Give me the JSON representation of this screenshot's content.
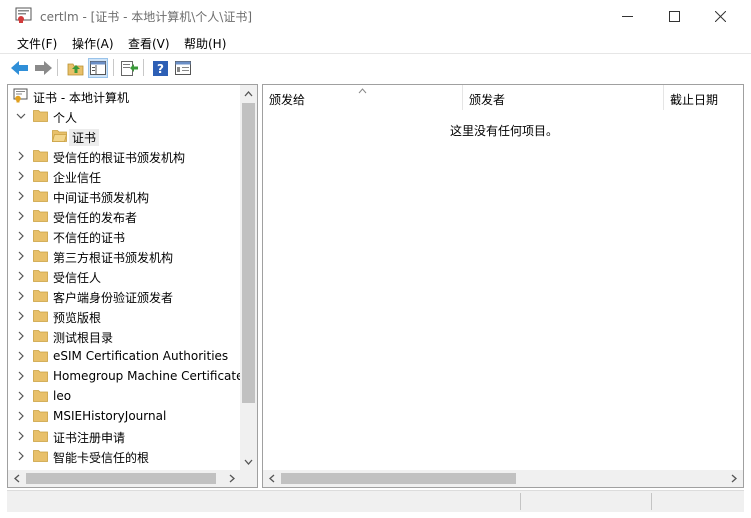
{
  "window": {
    "title": "certlm - [证书 - 本地计算机\\个人\\证书]"
  },
  "menu": [
    "文件(F)",
    "操作(A)",
    "查看(V)",
    "帮助(H)"
  ],
  "toolbar": {
    "icons": [
      "back-icon",
      "forward-icon",
      "up-folder-icon",
      "show-hide-console-tree-icon",
      "export-list-icon",
      "help-icon",
      "properties-icon"
    ]
  },
  "tree": {
    "root": "证书 - 本地计算机",
    "items": [
      {
        "label": "个人",
        "expanded": true
      },
      {
        "label": "证书",
        "selected": true
      },
      {
        "label": "受信任的根证书颁发机构"
      },
      {
        "label": "企业信任"
      },
      {
        "label": "中间证书颁发机构"
      },
      {
        "label": "受信任的发布者"
      },
      {
        "label": "不信任的证书"
      },
      {
        "label": "第三方根证书颁发机构"
      },
      {
        "label": "受信任人"
      },
      {
        "label": "客户端身份验证颁发者"
      },
      {
        "label": "预览版根"
      },
      {
        "label": "测试根目录"
      },
      {
        "label": "eSIM Certification Authorities"
      },
      {
        "label": "Homegroup Machine Certificates"
      },
      {
        "label": "leo"
      },
      {
        "label": "MSIEHistoryJournal"
      },
      {
        "label": "证书注册申请"
      },
      {
        "label": "智能卡受信任的根"
      }
    ]
  },
  "list": {
    "columns": [
      "颁发给",
      "颁发者",
      "截止日期"
    ],
    "empty_message": "这里没有任何项目。"
  },
  "colors": {
    "folder": "#e8c06a",
    "selection": "#ececec",
    "scrollbar_thumb": "#c1c1c1"
  }
}
